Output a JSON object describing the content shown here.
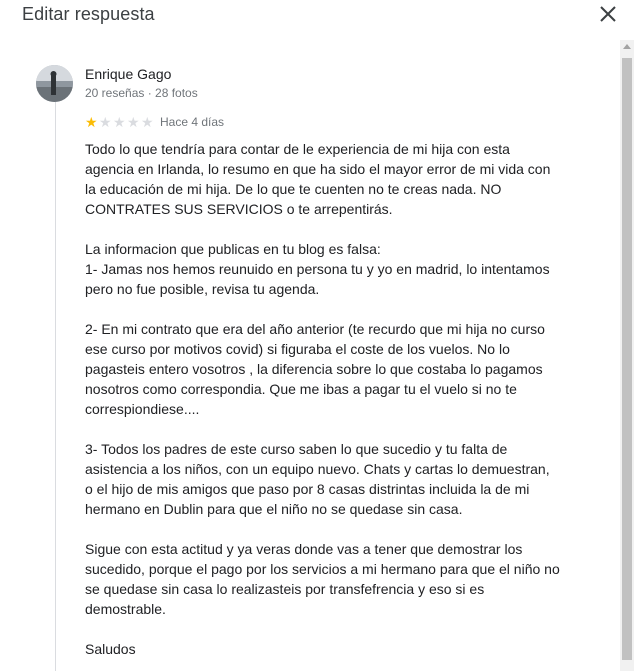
{
  "dialog": {
    "title": "Editar respuesta",
    "close_icon": "close-icon"
  },
  "review": {
    "reviewer_name": "Enrique Gago",
    "reviewer_meta": "20 reseñas · 28 fotos",
    "rating": 1,
    "rating_max": 5,
    "date": "Hace 4 días",
    "paragraphs": [
      [
        "Todo lo que tendría para contar de le experiencia de mi hija con esta",
        "agencia en Irlanda, lo resumo en que ha sido el mayor error de mi vida con",
        "la educación de mi hija. De lo que te cuenten no te creas nada. NO",
        "CONTRATES SUS SERVICIOS o te arrepentirás."
      ],
      [
        "La informacion que publicas en tu blog es falsa:",
        "1- Jamas nos hemos reunuido en persona tu y yo en madrid, lo intentamos",
        "pero no fue posible, revisa tu agenda."
      ],
      [
        "2- En mi contrato que era del año anterior (te recurdo que mi hija no curso",
        "ese curso por motivos covid) si figuraba el coste de los vuelos. No lo",
        "pagasteis entero vosotros , la diferencia sobre lo que costaba lo pagamos",
        "nosotros como correspondia. Que me ibas a pagar tu el vuelo si no te",
        "correspiondiese...."
      ],
      [
        "3- Todos los padres de este curso saben lo que sucedio y tu falta de",
        "asistencia a los niños, con un equipo nuevo. Chats y cartas lo demuestran,",
        "o el hijo de mis amigos que paso por 8 casas distrintas incluida la de mi",
        "hermano en Dublin para que el niño no se quedase sin casa."
      ],
      [
        "Sigue con esta actitud y ya veras donde vas a tener que demostrar los",
        "sucedido, porque el pago por los servicios a mi hermano para que el niño no",
        "se quedase sin casa lo realizasteis por transfefrencia y eso si es",
        "demostrable."
      ],
      [
        "Saludos"
      ]
    ]
  },
  "colors": {
    "star_filled": "#fbbc04",
    "star_empty": "#dadce0",
    "meta_text": "#70757a"
  }
}
